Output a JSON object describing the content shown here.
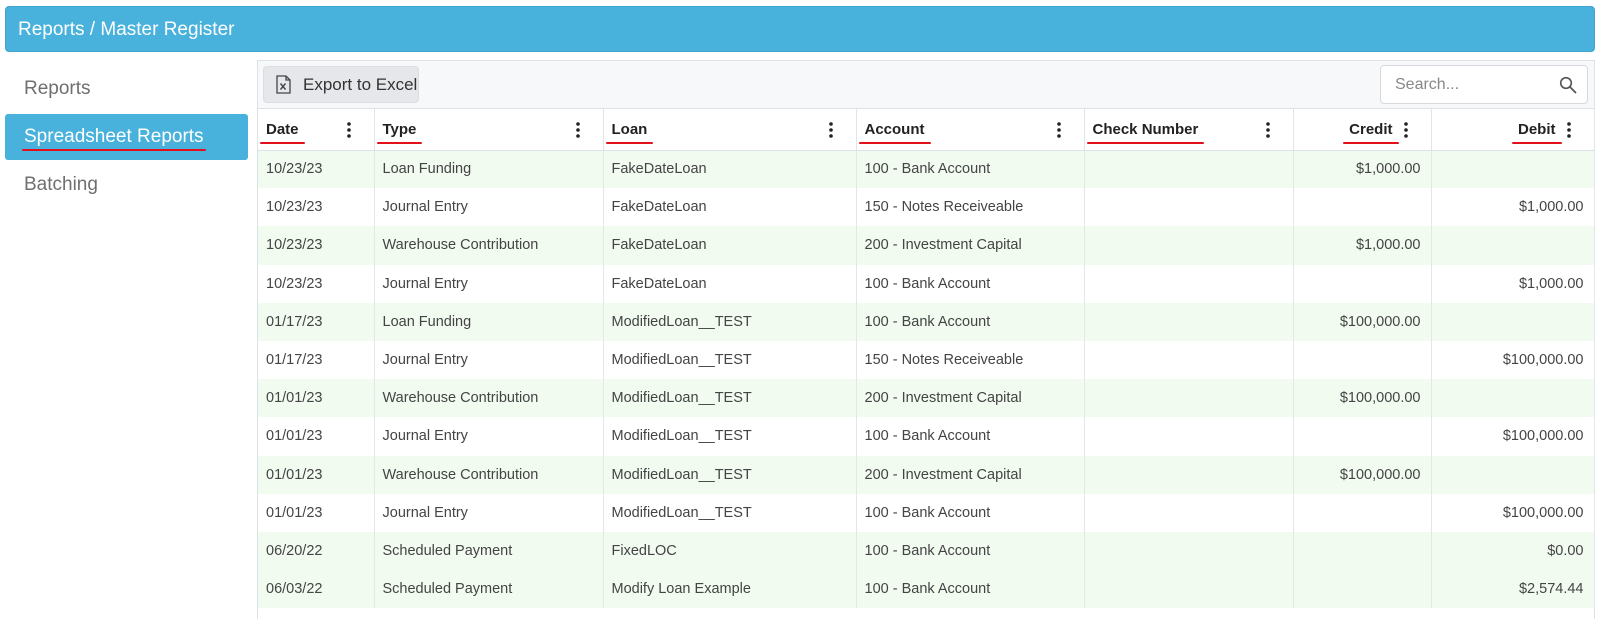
{
  "header": {
    "title": "Reports / Master Register"
  },
  "sidebar": {
    "items": [
      {
        "label": "Reports"
      },
      {
        "label": "Spreadsheet Reports"
      },
      {
        "label": "Batching"
      }
    ]
  },
  "toolbar": {
    "export_label": "Export to Excel"
  },
  "search": {
    "placeholder": "Search..."
  },
  "table": {
    "columns": [
      "Date",
      "Type",
      "Loan",
      "Account",
      "Check Number",
      "Credit",
      "Debit"
    ],
    "rows": [
      {
        "date": "10/23/23",
        "type": "Loan Funding",
        "loan": "FakeDateLoan",
        "account": "100 - Bank Account",
        "check": "",
        "credit": "$1,000.00",
        "debit": ""
      },
      {
        "date": "10/23/23",
        "type": "Journal Entry",
        "loan": "FakeDateLoan",
        "account": "150 - Notes Receiveable",
        "check": "",
        "credit": "",
        "debit": "$1,000.00"
      },
      {
        "date": "10/23/23",
        "type": "Warehouse Contribution",
        "loan": "FakeDateLoan",
        "account": "200 - Investment Capital",
        "check": "",
        "credit": "$1,000.00",
        "debit": ""
      },
      {
        "date": "10/23/23",
        "type": "Journal Entry",
        "loan": "FakeDateLoan",
        "account": "100 - Bank Account",
        "check": "",
        "credit": "",
        "debit": "$1,000.00"
      },
      {
        "date": "01/17/23",
        "type": "Loan Funding",
        "loan": "ModifiedLoan__TEST",
        "account": "100 - Bank Account",
        "check": "",
        "credit": "$100,000.00",
        "debit": ""
      },
      {
        "date": "01/17/23",
        "type": "Journal Entry",
        "loan": "ModifiedLoan__TEST",
        "account": "150 - Notes Receiveable",
        "check": "",
        "credit": "",
        "debit": "$100,000.00"
      },
      {
        "date": "01/01/23",
        "type": "Warehouse Contribution",
        "loan": "ModifiedLoan__TEST",
        "account": "200 - Investment Capital",
        "check": "",
        "credit": "$100,000.00",
        "debit": ""
      },
      {
        "date": "01/01/23",
        "type": "Journal Entry",
        "loan": "ModifiedLoan__TEST",
        "account": "100 - Bank Account",
        "check": "",
        "credit": "",
        "debit": "$100,000.00"
      },
      {
        "date": "01/01/23",
        "type": "Warehouse Contribution",
        "loan": "ModifiedLoan__TEST",
        "account": "200 - Investment Capital",
        "check": "",
        "credit": "$100,000.00",
        "debit": ""
      },
      {
        "date": "01/01/23",
        "type": "Journal Entry",
        "loan": "ModifiedLoan__TEST",
        "account": "100 - Bank Account",
        "check": "",
        "credit": "",
        "debit": "$100,000.00"
      },
      {
        "date": "06/20/22",
        "type": "Scheduled Payment",
        "loan": "FixedLOC",
        "account": "100 - Bank Account",
        "check": "",
        "credit": "",
        "debit": "$0.00"
      },
      {
        "date": "06/03/22",
        "type": "Scheduled Payment",
        "loan": "Modify Loan Example",
        "account": "100 - Bank Account",
        "check": "",
        "credit": "",
        "debit": "$2,574.44"
      }
    ]
  },
  "colors": {
    "accent": "#48b1dc",
    "row_alt": "#f1fbf0",
    "underline": "#e3101c"
  }
}
